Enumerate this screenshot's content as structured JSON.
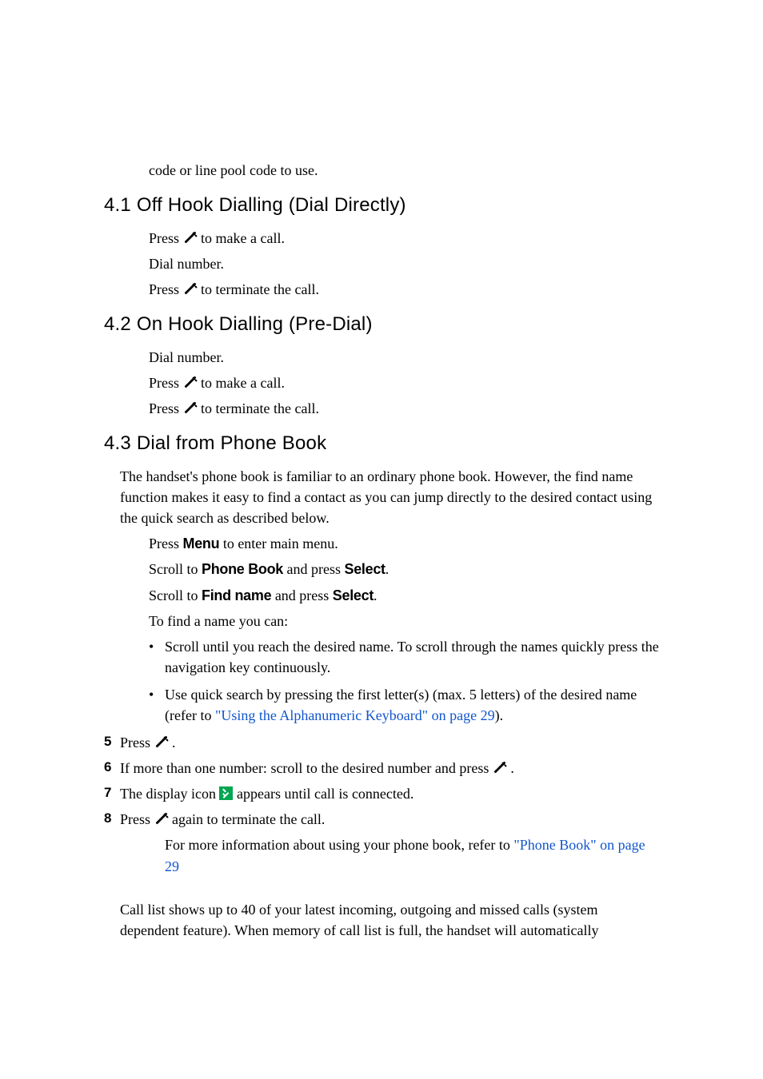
{
  "intro": {
    "line1": "code or line pool code to use."
  },
  "sections": {
    "s41": {
      "heading": "4.1  Off Hook Dialling (Dial Directly)",
      "l1a": "Press ",
      "l1b": " to make a call.",
      "l2": "Dial number.",
      "l3a": "Press ",
      "l3b": " to terminate the call."
    },
    "s42": {
      "heading": "4.2  On Hook Dialling (Pre-Dial)",
      "l1": "Dial number.",
      "l2a": "Press ",
      "l2b": " to make a call.",
      "l3a": "Press ",
      "l3b": " to terminate the call."
    },
    "s43": {
      "heading": "4.3  Dial from Phone Book",
      "intro": "The handset's phone book is familiar to an ordinary phone book. However, the find name function makes it easy to find a contact as you can jump directly to the desired contact using the quick search as described below.",
      "step_a": "Press ",
      "menu_label": "Menu",
      "step_a2": " to enter main menu.",
      "step_b": "Scroll to ",
      "phonebook_label": "Phone Book",
      "step_b2": " and press ",
      "select_label": "Select",
      "dot": ".",
      "step_c": "Scroll to ",
      "findname_label": "Find name",
      "step_c2": " and press ",
      "step_d": "To find a name you can:",
      "bullets": {
        "b1": "Scroll until you reach the desired name. To scroll through the names quickly press the navigation key continuously.",
        "b2a": "Use quick search by pressing the first letter(s) (max. 5 letters) of the desired name (refer to ",
        "b2_link": "\"Using the Alphanumeric Keyboard\" on page 29",
        "b2b": ")."
      },
      "steps": {
        "n5": "5",
        "t5a": "Press ",
        "t5b": " .",
        "n6": "6",
        "t6a": "If more than one number: scroll to the desired number and press ",
        "t6b": " .",
        "n7": "7",
        "t7a": "The display icon ",
        "t7b": " appears until call is connected.",
        "n8": "8",
        "t8a": "Press ",
        "t8b": " again to terminate the call."
      },
      "note_a": "For more information about using your phone book, refer to ",
      "note_link": "\"Phone Book\" on page 29"
    }
  },
  "footer": "Call list shows up to 40 of your latest incoming, outgoing and missed calls (system dependent feature). When memory of call list is full, the handset will automatically"
}
